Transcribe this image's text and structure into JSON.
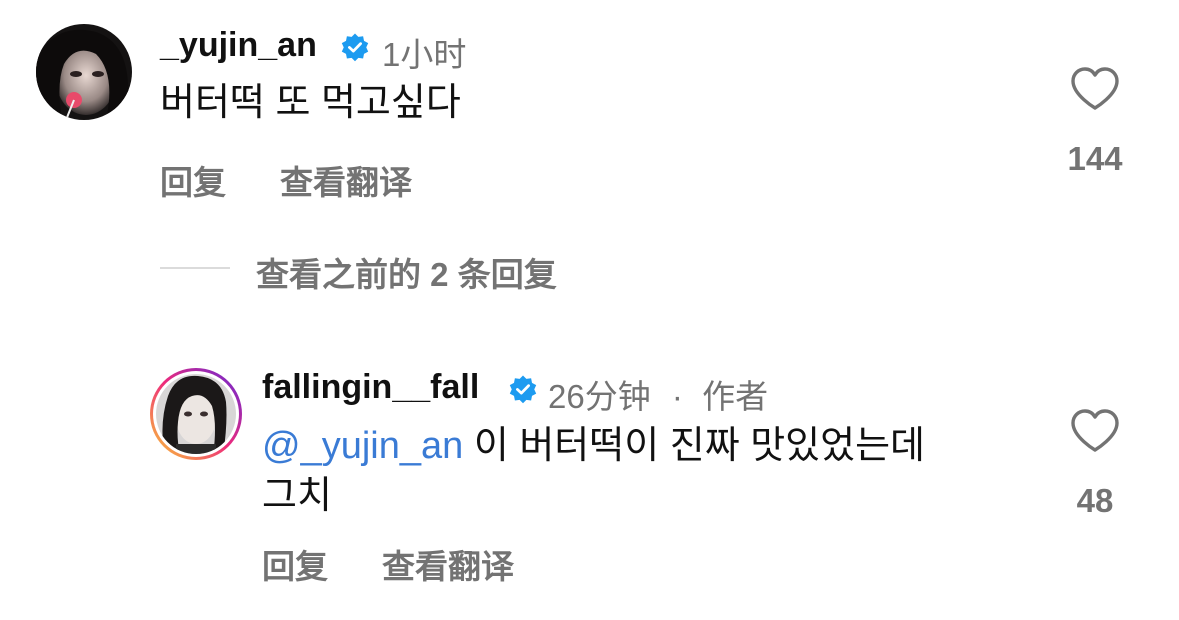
{
  "comment": {
    "username": "_yujin_an",
    "time": "1小时",
    "text": "버터떡 또 먹고싶다",
    "reply_label": "回复",
    "translate_label": "查看翻译",
    "likes": "144"
  },
  "view_previous": {
    "label": "查看之前的 2 条回复"
  },
  "reply": {
    "username": "fallingin__fall",
    "time": "26分钟",
    "separator": "·",
    "role": "作者",
    "mention": "@_yujin_an",
    "text_line1": " 이 버터떡이 진짜 맛있었는데",
    "text_line2": "그치",
    "reply_label": "回复",
    "translate_label": "查看翻译",
    "likes": "48"
  },
  "icons": {
    "verified": "verified-badge-icon",
    "heart": "heart-outline-icon"
  },
  "colors": {
    "verified_blue": "#1d9bf0",
    "mention_blue": "#3a7bd5",
    "meta_gray": "#737373",
    "story_ring_start": "#f9ce34",
    "story_ring_mid": "#ee2a7b",
    "story_ring_end": "#6228d7"
  }
}
